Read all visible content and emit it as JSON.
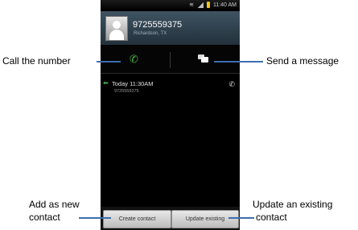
{
  "status_bar": {
    "time": "11:40 AM"
  },
  "contact": {
    "number": "9725559375",
    "location": "Richardson, TX"
  },
  "call_log": [
    {
      "label": "Today 11:30AM",
      "number": "9725559375"
    }
  ],
  "buttons": {
    "create": "Create contact",
    "update": "Update existing"
  },
  "callouts": {
    "call": "Call the number",
    "send": "Send a message",
    "add_line1": "Add as new",
    "add_line2": "contact",
    "update_line1": "Update an existing",
    "update_line2": "contact"
  },
  "icons": {
    "avatar": "person-icon",
    "call": "phone-icon",
    "message": "message-icon"
  },
  "colors": {
    "callout_line": "#3c6db0",
    "call_green": "#4fb54f",
    "header": "#34495a"
  }
}
